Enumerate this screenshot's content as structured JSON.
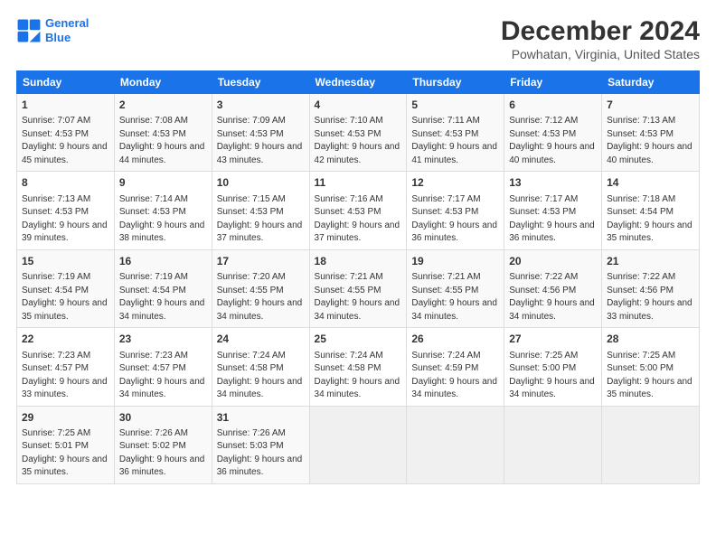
{
  "header": {
    "logo_line1": "General",
    "logo_line2": "Blue",
    "main_title": "December 2024",
    "subtitle": "Powhatan, Virginia, United States"
  },
  "days_of_week": [
    "Sunday",
    "Monday",
    "Tuesday",
    "Wednesday",
    "Thursday",
    "Friday",
    "Saturday"
  ],
  "weeks": [
    [
      {
        "day": "1",
        "sunrise": "Sunrise: 7:07 AM",
        "sunset": "Sunset: 4:53 PM",
        "daylight": "Daylight: 9 hours and 45 minutes."
      },
      {
        "day": "2",
        "sunrise": "Sunrise: 7:08 AM",
        "sunset": "Sunset: 4:53 PM",
        "daylight": "Daylight: 9 hours and 44 minutes."
      },
      {
        "day": "3",
        "sunrise": "Sunrise: 7:09 AM",
        "sunset": "Sunset: 4:53 PM",
        "daylight": "Daylight: 9 hours and 43 minutes."
      },
      {
        "day": "4",
        "sunrise": "Sunrise: 7:10 AM",
        "sunset": "Sunset: 4:53 PM",
        "daylight": "Daylight: 9 hours and 42 minutes."
      },
      {
        "day": "5",
        "sunrise": "Sunrise: 7:11 AM",
        "sunset": "Sunset: 4:53 PM",
        "daylight": "Daylight: 9 hours and 41 minutes."
      },
      {
        "day": "6",
        "sunrise": "Sunrise: 7:12 AM",
        "sunset": "Sunset: 4:53 PM",
        "daylight": "Daylight: 9 hours and 40 minutes."
      },
      {
        "day": "7",
        "sunrise": "Sunrise: 7:13 AM",
        "sunset": "Sunset: 4:53 PM",
        "daylight": "Daylight: 9 hours and 40 minutes."
      }
    ],
    [
      {
        "day": "8",
        "sunrise": "Sunrise: 7:13 AM",
        "sunset": "Sunset: 4:53 PM",
        "daylight": "Daylight: 9 hours and 39 minutes."
      },
      {
        "day": "9",
        "sunrise": "Sunrise: 7:14 AM",
        "sunset": "Sunset: 4:53 PM",
        "daylight": "Daylight: 9 hours and 38 minutes."
      },
      {
        "day": "10",
        "sunrise": "Sunrise: 7:15 AM",
        "sunset": "Sunset: 4:53 PM",
        "daylight": "Daylight: 9 hours and 37 minutes."
      },
      {
        "day": "11",
        "sunrise": "Sunrise: 7:16 AM",
        "sunset": "Sunset: 4:53 PM",
        "daylight": "Daylight: 9 hours and 37 minutes."
      },
      {
        "day": "12",
        "sunrise": "Sunrise: 7:17 AM",
        "sunset": "Sunset: 4:53 PM",
        "daylight": "Daylight: 9 hours and 36 minutes."
      },
      {
        "day": "13",
        "sunrise": "Sunrise: 7:17 AM",
        "sunset": "Sunset: 4:53 PM",
        "daylight": "Daylight: 9 hours and 36 minutes."
      },
      {
        "day": "14",
        "sunrise": "Sunrise: 7:18 AM",
        "sunset": "Sunset: 4:54 PM",
        "daylight": "Daylight: 9 hours and 35 minutes."
      }
    ],
    [
      {
        "day": "15",
        "sunrise": "Sunrise: 7:19 AM",
        "sunset": "Sunset: 4:54 PM",
        "daylight": "Daylight: 9 hours and 35 minutes."
      },
      {
        "day": "16",
        "sunrise": "Sunrise: 7:19 AM",
        "sunset": "Sunset: 4:54 PM",
        "daylight": "Daylight: 9 hours and 34 minutes."
      },
      {
        "day": "17",
        "sunrise": "Sunrise: 7:20 AM",
        "sunset": "Sunset: 4:55 PM",
        "daylight": "Daylight: 9 hours and 34 minutes."
      },
      {
        "day": "18",
        "sunrise": "Sunrise: 7:21 AM",
        "sunset": "Sunset: 4:55 PM",
        "daylight": "Daylight: 9 hours and 34 minutes."
      },
      {
        "day": "19",
        "sunrise": "Sunrise: 7:21 AM",
        "sunset": "Sunset: 4:55 PM",
        "daylight": "Daylight: 9 hours and 34 minutes."
      },
      {
        "day": "20",
        "sunrise": "Sunrise: 7:22 AM",
        "sunset": "Sunset: 4:56 PM",
        "daylight": "Daylight: 9 hours and 34 minutes."
      },
      {
        "day": "21",
        "sunrise": "Sunrise: 7:22 AM",
        "sunset": "Sunset: 4:56 PM",
        "daylight": "Daylight: 9 hours and 33 minutes."
      }
    ],
    [
      {
        "day": "22",
        "sunrise": "Sunrise: 7:23 AM",
        "sunset": "Sunset: 4:57 PM",
        "daylight": "Daylight: 9 hours and 33 minutes."
      },
      {
        "day": "23",
        "sunrise": "Sunrise: 7:23 AM",
        "sunset": "Sunset: 4:57 PM",
        "daylight": "Daylight: 9 hours and 34 minutes."
      },
      {
        "day": "24",
        "sunrise": "Sunrise: 7:24 AM",
        "sunset": "Sunset: 4:58 PM",
        "daylight": "Daylight: 9 hours and 34 minutes."
      },
      {
        "day": "25",
        "sunrise": "Sunrise: 7:24 AM",
        "sunset": "Sunset: 4:58 PM",
        "daylight": "Daylight: 9 hours and 34 minutes."
      },
      {
        "day": "26",
        "sunrise": "Sunrise: 7:24 AM",
        "sunset": "Sunset: 4:59 PM",
        "daylight": "Daylight: 9 hours and 34 minutes."
      },
      {
        "day": "27",
        "sunrise": "Sunrise: 7:25 AM",
        "sunset": "Sunset: 5:00 PM",
        "daylight": "Daylight: 9 hours and 34 minutes."
      },
      {
        "day": "28",
        "sunrise": "Sunrise: 7:25 AM",
        "sunset": "Sunset: 5:00 PM",
        "daylight": "Daylight: 9 hours and 35 minutes."
      }
    ],
    [
      {
        "day": "29",
        "sunrise": "Sunrise: 7:25 AM",
        "sunset": "Sunset: 5:01 PM",
        "daylight": "Daylight: 9 hours and 35 minutes."
      },
      {
        "day": "30",
        "sunrise": "Sunrise: 7:26 AM",
        "sunset": "Sunset: 5:02 PM",
        "daylight": "Daylight: 9 hours and 36 minutes."
      },
      {
        "day": "31",
        "sunrise": "Sunrise: 7:26 AM",
        "sunset": "Sunset: 5:03 PM",
        "daylight": "Daylight: 9 hours and 36 minutes."
      },
      null,
      null,
      null,
      null
    ]
  ]
}
